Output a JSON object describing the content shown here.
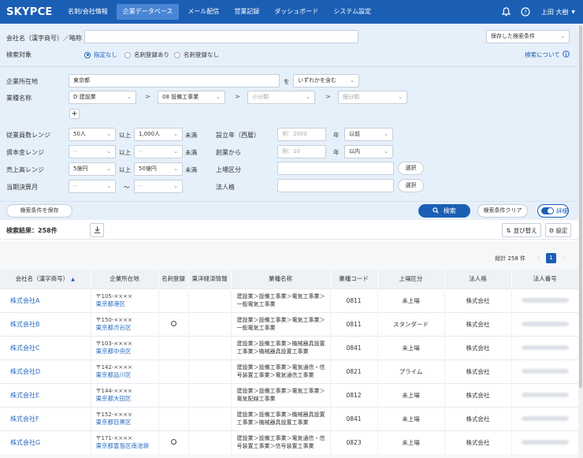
{
  "nav": {
    "logo": "SKYPCE",
    "items": [
      "名刺/会社情報",
      "企業データベース",
      "メール配信",
      "営業記録",
      "ダッシュボード",
      "システム設定"
    ],
    "user": "上田 大樹"
  },
  "search": {
    "company_label": "会社名（漢字商号）／略称",
    "company_value": "",
    "saved_conditions": "保存した検索条件",
    "target_label": "検索対象",
    "target_options": [
      "指定なし",
      "名刺登録あり",
      "名刺登録なし"
    ],
    "help_link": "検索について",
    "address_label": "企業所在地",
    "address_value": "東京都",
    "address_wo": "を",
    "address_match": "いずれかを含む",
    "industry_label": "業種名称",
    "industry_1": "D 建設業",
    "industry_2": "08 設備工事業",
    "industry_3": "小分類",
    "industry_4": "細分類",
    "employees_label": "従業員数レンジ",
    "employees_from": "50人",
    "employees_to": "1,000人",
    "capital_label": "資本金レンジ",
    "capital_from": "--",
    "capital_to": "--",
    "sales_label": "売上高レンジ",
    "sales_from": "5億円",
    "sales_to": "50億円",
    "fiscal_label": "当期決算月",
    "fiscal_from": "--",
    "fiscal_to": "--",
    "ijo": "以上",
    "miman": "未満",
    "tilde": "〜",
    "established_label": "設立年（西暦）",
    "established_placeholder": "例：2000",
    "established_unit": "年",
    "established_cmp": "以前",
    "founded_label": "創業から",
    "founded_placeholder": "例：10",
    "founded_unit": "年",
    "founded_cmp": "以内",
    "listing_label": "上場区分",
    "corp_label": "法人格",
    "select_btn": "選択",
    "save_btn": "検索条件を保存",
    "search_btn": "検索",
    "clear_btn": "検索条件クリア",
    "detail_toggle": "詳細"
  },
  "results": {
    "count_label": "検索結果：258件",
    "sort_btn": "並び替え",
    "settings_btn": "設定",
    "total": "総計 258 件",
    "page": "1",
    "columns": [
      "会社名（漢字商号）",
      "企業所在地",
      "名刺登録",
      "東洋経済情報",
      "業種名称",
      "業種コード",
      "上場区分",
      "法人格",
      "法人番号"
    ],
    "rows": [
      {
        "name": "株式会社A",
        "zip": "〒105-××××",
        "city": "東京都港区",
        "card": false,
        "ind1": "建設業＞設備工事業＞電気工事業＞",
        "ind2": "一般電気工事業",
        "code": "0811",
        "listing": "未上場",
        "corp": "株式会社"
      },
      {
        "name": "株式会社B",
        "zip": "〒150-××××",
        "city": "東京都渋谷区",
        "card": true,
        "ind1": "建設業＞設備工事業＞電気工事業＞",
        "ind2": "一般電気工事業",
        "code": "0811",
        "listing": "スタンダード",
        "corp": "株式会社"
      },
      {
        "name": "株式会社C",
        "zip": "〒103-××××",
        "city": "東京都中央区",
        "card": false,
        "ind1": "建設業＞設備工事業＞機械器具設置",
        "ind2": "工事業＞機械器具設置工事業",
        "code": "0841",
        "listing": "未上場",
        "corp": "株式会社"
      },
      {
        "name": "株式会社D",
        "zip": "〒142-××××",
        "city": "東京都品川区",
        "card": false,
        "ind1": "建設業＞設備工事業＞電気通信・信",
        "ind2": "号装置工事業＞電気通信工事業",
        "code": "0821",
        "listing": "プライム",
        "corp": "株式会社"
      },
      {
        "name": "株式会社E",
        "zip": "〒144-××××",
        "city": "東京都大田区",
        "card": false,
        "ind1": "建設業＞設備工事業＞電気工事業＞",
        "ind2": "電気配線工事業",
        "code": "0812",
        "listing": "未上場",
        "corp": "株式会社"
      },
      {
        "name": "株式会社F",
        "zip": "〒152-××××",
        "city": "東京都目黒区",
        "card": false,
        "ind1": "建設業＞設備工事業＞機械器具設置",
        "ind2": "工事業＞機械器具設置工事業",
        "code": "0841",
        "listing": "未上場",
        "corp": "株式会社"
      },
      {
        "name": "株式会社G",
        "zip": "〒171-××××",
        "city": "東京都豊島区南池袋",
        "card": true,
        "ind1": "建設業＞設備工事業＞電気通信・信",
        "ind2": "号装置工事業＞信号装置工事業",
        "code": "0823",
        "listing": "未上場",
        "corp": "株式会社"
      }
    ]
  },
  "colors": {
    "primary": "#1b5fb5",
    "panel": "#e6f0fb",
    "link": "#2a6bbf"
  }
}
